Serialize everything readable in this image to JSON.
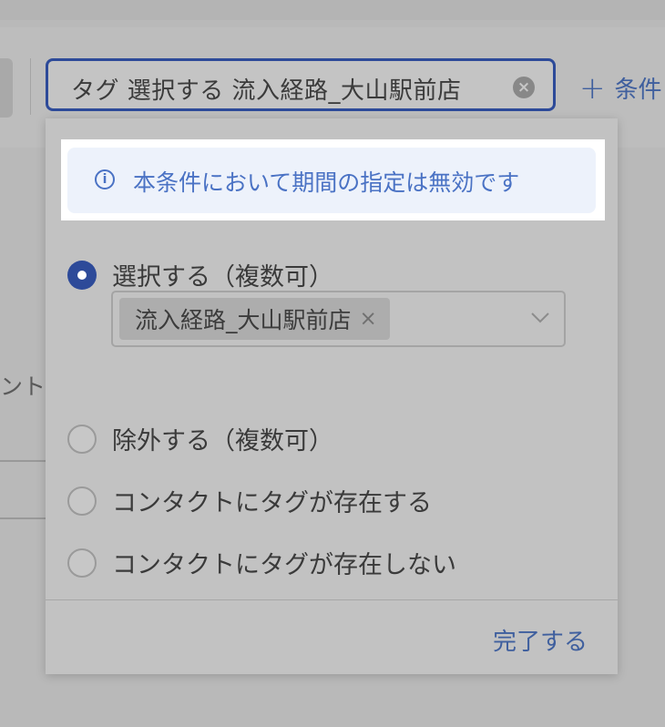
{
  "filter_chip": {
    "text": "タグ 選択する 流入経路_大山駅前店"
  },
  "add_condition": {
    "label": "条件"
  },
  "background": {
    "partial_text": "ント"
  },
  "dropdown": {
    "info_message": "本条件において期間の指定は無効です",
    "options": [
      {
        "label": "選択する（複数可）",
        "selected": true
      },
      {
        "label": "除外する（複数可）",
        "selected": false
      },
      {
        "label": "コンタクトにタグが存在する",
        "selected": false
      },
      {
        "label": "コンタクトにタグが存在しない",
        "selected": false
      }
    ],
    "selected_tag": "流入経路_大山駅前店",
    "done_label": "完了する"
  },
  "colors": {
    "accent": "#2d4a99",
    "link": "#3f5f9e",
    "info": "#4a72c4",
    "info_bg": "#edf2fb"
  }
}
